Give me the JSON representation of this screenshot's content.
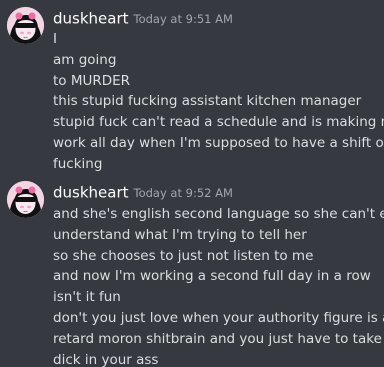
{
  "messages": [
    {
      "username": "duskheart",
      "timestamp": "Today at 9:51 AM",
      "avatar_icon": "anime-avatar-icon",
      "lines": [
        "I",
        "am going",
        "to MURDER",
        "this stupid fucking assistant kitchen manager",
        "stupid fuck can't read a schedule and is making me",
        "work all day when I'm supposed to have a shift off",
        "fucking"
      ]
    },
    {
      "username": "duskheart",
      "timestamp": "Today at 9:52 AM",
      "avatar_icon": "anime-avatar-icon",
      "lines": [
        "and she's english second language so she can't even",
        "understand what I'm trying to tell her",
        "so she chooses to just not listen to me",
        "and now I'm working a second full day in a row",
        "isn't it fun",
        "don't you just love when your authority figure is a",
        "retard moron shitbrain and you just have to take the",
        "dick in your ass"
      ]
    }
  ],
  "colors": {
    "background": "#36393f",
    "username": "#ffffff",
    "timestamp": "#a3a6aa",
    "message_text": "#dcddde"
  }
}
